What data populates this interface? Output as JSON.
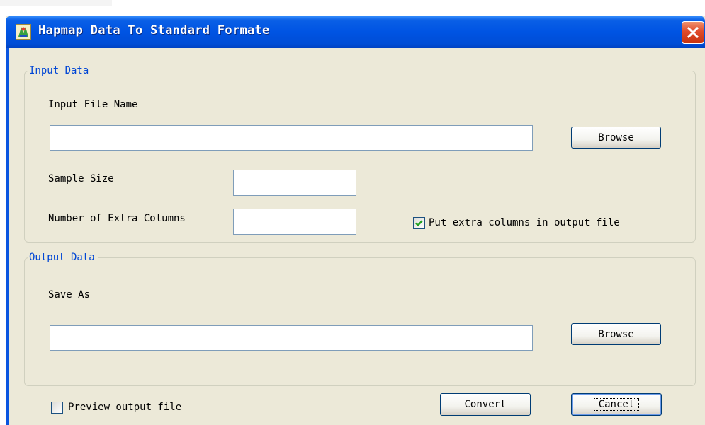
{
  "window": {
    "title": "Hapmap Data To Standard Formate",
    "close_icon": "close-x-icon"
  },
  "input_group": {
    "legend": "Input Data",
    "file_label": "Input File Name",
    "file_value": "",
    "browse_label": "Browse",
    "sample_size_label": "Sample Size",
    "sample_size_value": "",
    "extra_cols_label": "Number of Extra Columns",
    "extra_cols_value": "",
    "put_extra_label": "Put extra columns in output file",
    "put_extra_checked": true
  },
  "output_group": {
    "legend": "Output Data",
    "save_as_label": "Save As",
    "save_as_value": "",
    "browse_label": "Browse"
  },
  "footer": {
    "preview_label": "Preview output file",
    "preview_checked": false,
    "convert_label": "Convert",
    "cancel_label": "Cancel"
  },
  "colors": {
    "title_bar": "#0054e3",
    "legend_text": "#0046d5",
    "window_bg": "#ece9d8",
    "close_button": "#e04a2a"
  }
}
